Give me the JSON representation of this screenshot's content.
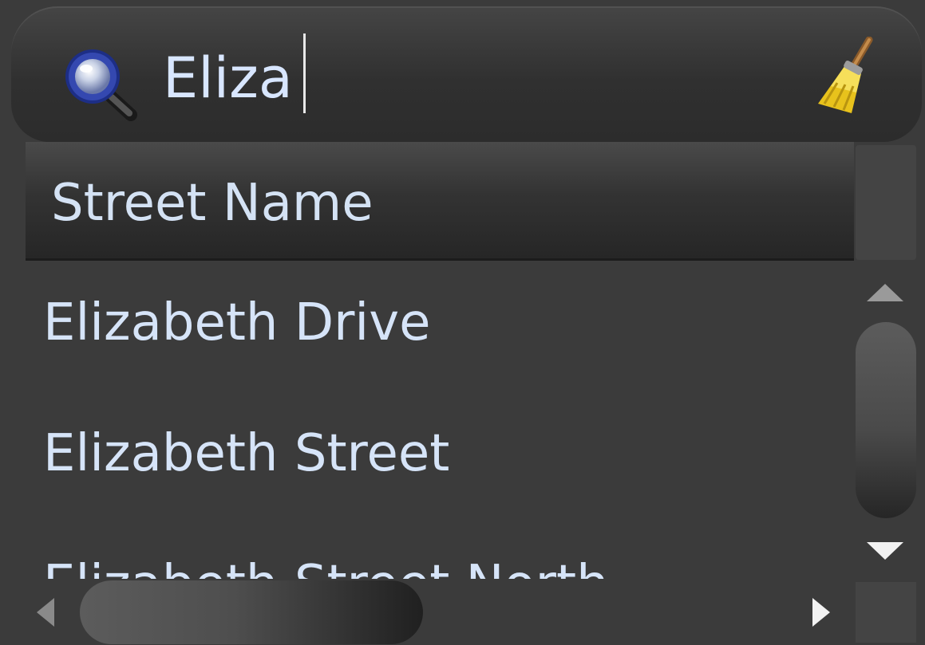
{
  "search": {
    "query": "Eliza",
    "icon": "search-icon",
    "clear_icon": "broom-icon"
  },
  "list": {
    "header": "Street Name",
    "rows": [
      "Elizabeth Drive",
      "Elizabeth Street",
      "Elizabeth Street North"
    ]
  },
  "colors": {
    "background": "#3b3b3b",
    "text": "#d6e4f8",
    "header_dark": "#262626"
  }
}
